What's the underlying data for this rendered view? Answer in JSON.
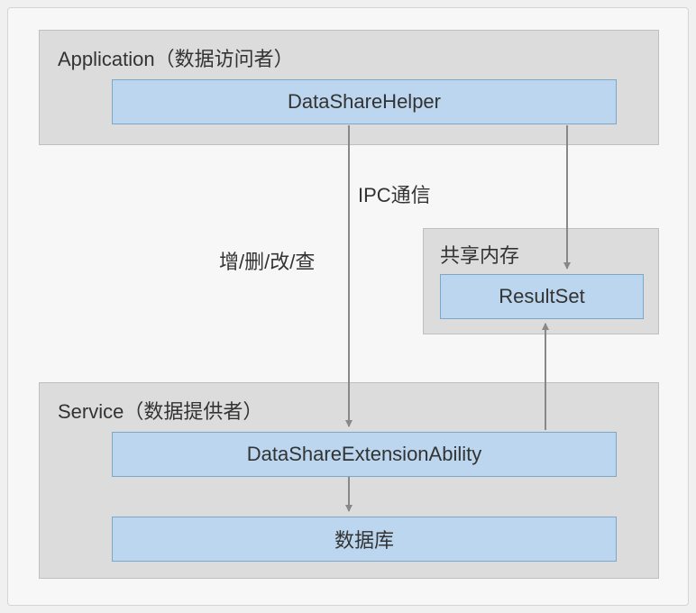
{
  "application": {
    "title": "Application（数据访问者）",
    "helper_label": "DataShareHelper"
  },
  "ipc": {
    "label": "IPC通信",
    "crud_label": "增/删/改/查"
  },
  "shared_memory": {
    "title": "共享内存",
    "resultset_label": "ResultSet"
  },
  "service": {
    "title": "Service（数据提供者）",
    "extension_label": "DataShareExtensionAbility",
    "database_label": "数据库"
  }
}
